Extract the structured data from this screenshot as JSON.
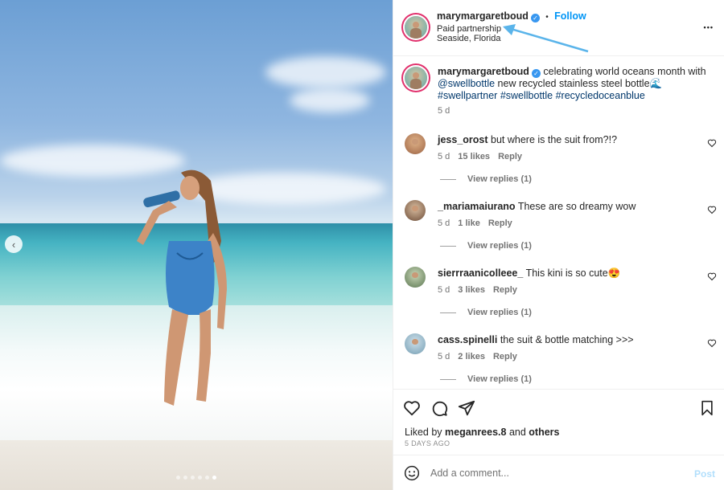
{
  "post": {
    "username": "marymargaretboud",
    "follow_label": "Follow",
    "separator": "•",
    "partnership": "Paid partnership",
    "location": "Seaside, Florida",
    "more_label": "•••"
  },
  "caption": {
    "username": "marymargaretboud",
    "text": " celebrating world oceans month with ",
    "mention": "@swellbottle",
    "text2": " new recycled stainless steel bottle🌊",
    "hashtags": "#swellpartner #swellbottle #recycledoceanblue",
    "time": "5 d"
  },
  "comments": [
    {
      "username": "jess_orost",
      "text": " but where is the suit from?!?",
      "time": "5 d",
      "likes": "15 likes",
      "reply": "Reply",
      "view_replies": "View replies (1)"
    },
    {
      "username": "_mariamaiurano",
      "text": " These are so dreamy wow",
      "time": "5 d",
      "likes": "1 like",
      "reply": "Reply",
      "view_replies": "View replies (1)"
    },
    {
      "username": "sierrraanicolleee_",
      "text": " This kini is so cute😍",
      "time": "5 d",
      "likes": "3 likes",
      "reply": "Reply",
      "view_replies": "View replies (1)"
    },
    {
      "username": "cass.spinelli",
      "text": " the suit & bottle matching >>>",
      "time": "5 d",
      "likes": "2 likes",
      "reply": "Reply",
      "view_replies": "View replies (1)"
    }
  ],
  "actions": {
    "liked_by_prefix": "Liked by ",
    "liked_by_user": "meganrees.8",
    "liked_by_and": " and ",
    "liked_by_others": "others",
    "time_ago": "5 DAYS AGO"
  },
  "add_comment": {
    "placeholder": "Add a comment...",
    "post_label": "Post"
  },
  "carousel": {
    "total": 6,
    "active": 6
  },
  "colors": {
    "accent": "#0095f6",
    "verified": "#3897f0",
    "annotation_arrow": "#5ab4ea"
  },
  "icons": [
    "chevron-left-icon",
    "verified-icon",
    "more-icon",
    "heart-icon",
    "comment-icon",
    "share-icon",
    "bookmark-icon",
    "emoji-icon"
  ]
}
